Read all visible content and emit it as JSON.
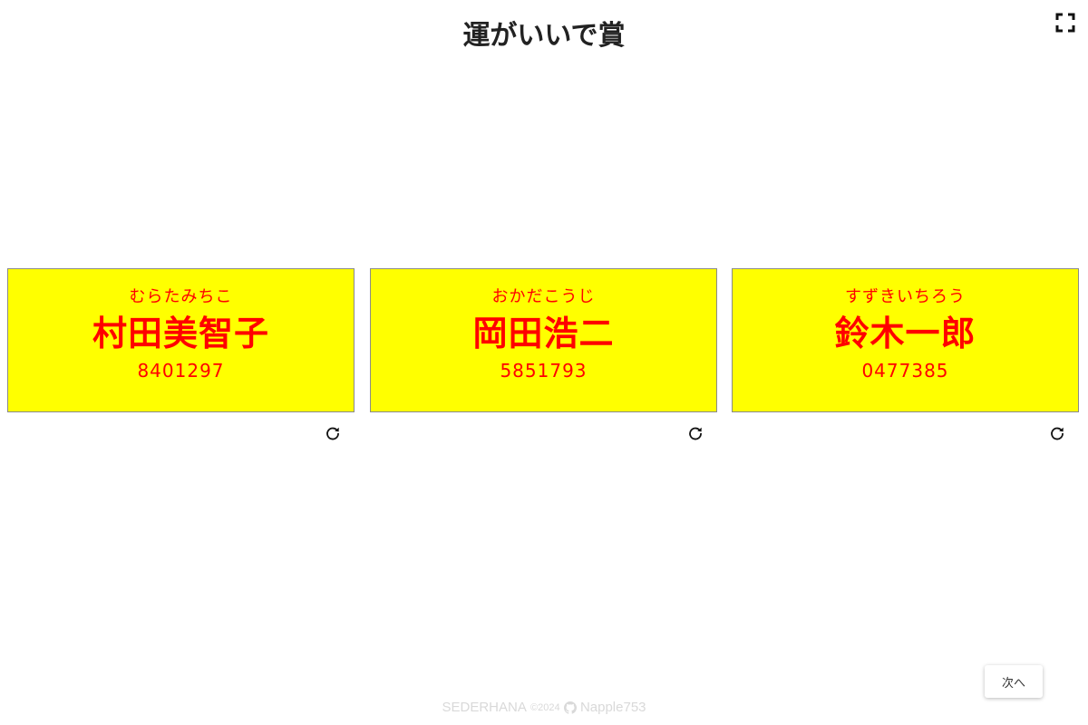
{
  "header": {
    "title": "運がいいで賞"
  },
  "icons": {
    "fullscreen": "fullscreen-icon",
    "refresh": "refresh-icon",
    "github": "github-icon"
  },
  "cards": [
    {
      "reading": "むらたみちこ",
      "name": "村田美智子",
      "number": "8401297"
    },
    {
      "reading": "おかだこうじ",
      "name": "岡田浩二",
      "number": "5851793"
    },
    {
      "reading": "すずきいちろう",
      "name": "鈴木一郎",
      "number": "0477385"
    }
  ],
  "colors": {
    "card_background": "#ffff00",
    "card_text": "#ff0000",
    "title_text": "#222222",
    "footer_text": "#d9d9d9"
  },
  "actions": {
    "next_label": "次へ"
  },
  "footer": {
    "brand": "SEDERHANA",
    "copyright": "©2024",
    "author": "Napple753"
  }
}
